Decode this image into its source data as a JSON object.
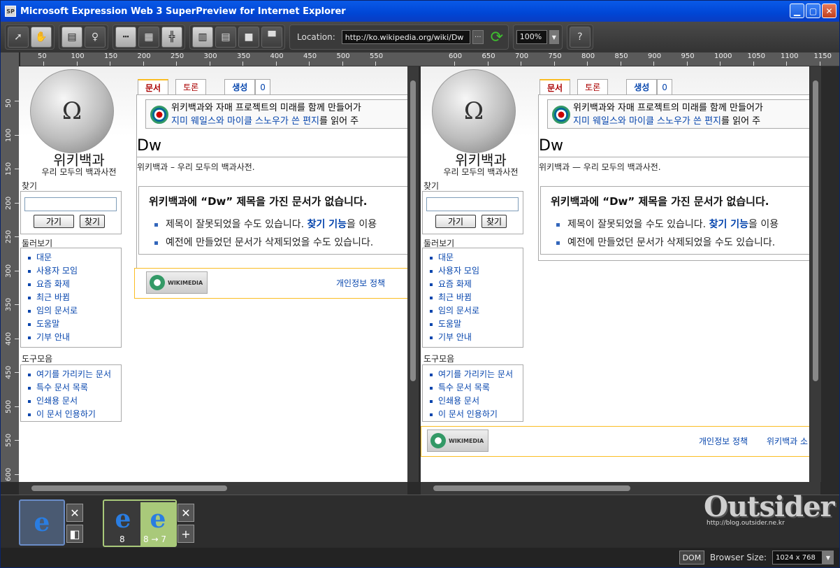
{
  "window": {
    "title": "Microsoft Expression Web 3 SuperPreview for Internet Explorer",
    "logo_text": "SP"
  },
  "toolbar": {
    "location_label": "Location:",
    "location_value": "http://ko.wikipedia.org/wiki/Dw",
    "location_more": "···",
    "zoom_value": "100%"
  },
  "rulers": {
    "h_labels": [
      "50",
      "100",
      "150",
      "200",
      "250",
      "300",
      "350",
      "400",
      "450",
      "500",
      "550",
      "600",
      "650",
      "700",
      "750",
      "800",
      "850",
      "900",
      "950",
      "1000",
      "1050",
      "1100",
      "1150"
    ],
    "v_labels": [
      "50",
      "100",
      "150",
      "200",
      "250",
      "300",
      "350",
      "400",
      "450",
      "500",
      "550",
      "600"
    ]
  },
  "wiki": {
    "logo_title": "위키백과",
    "logo_subtitle": "우리 모두의 백과사전",
    "search_label": "찾기",
    "go_button": "가기",
    "search_button": "찾기",
    "nav_label": "둘러보기",
    "nav_items": [
      "대문",
      "사용자 모임",
      "요즘 화제",
      "최근 바뀜",
      "임의 문서로",
      "도움말",
      "기부 안내"
    ],
    "tools_label": "도구모음",
    "tools_items": [
      "여기를 가리키는 문서",
      "특수 문서 목록",
      "인쇄용 문서",
      "이 문서 인용하기"
    ],
    "tabs": {
      "article": "문서",
      "talk": "토론",
      "create": "생성",
      "count": "0"
    },
    "notice_line1": "위키백과와 자매 프로젝트의 미래를 함께 만들어가",
    "notice_link": "지미 웨일스와 마이클 스노우가 쓴 편지",
    "notice_tail": "를 읽어 주",
    "heading": "Dw",
    "tagline_left": "위키백과 – 우리 모두의 백과사전.",
    "tagline_right": "위키백과 — 우리 모두의 백과사전.",
    "notfound_title": "위키백과에 “Dw” 제목을 가진 문서가 없습니다.",
    "notfound_item1_pre": "제목이 잘못되었을 수도 있습니다.",
    "notfound_item1_link": "찾기 기능",
    "notfound_item1_post": "을 이용",
    "notfound_item2": "예전에 만들었던 문서가 삭제되었을 수도 있습니다.",
    "wikimedia_a": "A",
    "wikimedia_name": "WIKIMEDIA",
    "wikimedia_project": "project",
    "footer_privacy": "개인정보 정책",
    "footer_about": "위키백과 소"
  },
  "browsers": {
    "baseline_close": "✕",
    "version_8": "8",
    "version_8_to_7": "8 → 7",
    "close": "✕",
    "add": "+"
  },
  "status": {
    "dom": "DOM",
    "browser_size_label": "Browser Size:",
    "browser_size_value": "1024 x 768"
  },
  "watermark": {
    "brand": "Outsider",
    "url": "http://blog.outsider.ne.kr"
  }
}
